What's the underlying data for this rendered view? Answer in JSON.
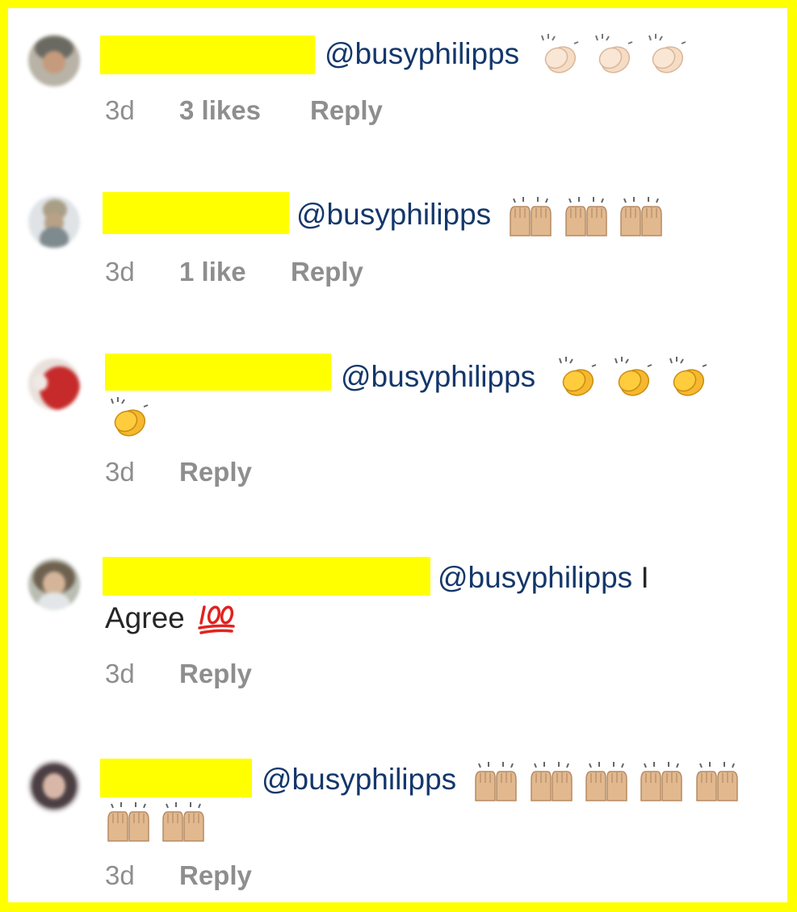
{
  "comments": [
    {
      "mention": "@busyphilipps",
      "text": "",
      "emoji": [
        "clapping-hands-light",
        "clapping-hands-light",
        "clapping-hands-light"
      ],
      "time": "3d",
      "likes": "3 likes",
      "reply": "Reply"
    },
    {
      "mention": "@busyphilipps",
      "text": "",
      "emoji": [
        "raising-hands-medium-light",
        "raising-hands-medium-light",
        "raising-hands-medium-light"
      ],
      "time": "3d",
      "likes": "1 like",
      "reply": "Reply"
    },
    {
      "mention": "@busyphilipps",
      "text": "",
      "emoji": [
        "clapping-hands-yellow",
        "clapping-hands-yellow",
        "clapping-hands-yellow",
        "clapping-hands-yellow"
      ],
      "time": "3d",
      "likes": "",
      "reply": "Reply"
    },
    {
      "mention": "@busyphilipps",
      "text": "I",
      "text2": "Agree",
      "emoji": [
        "hundred-points"
      ],
      "time": "3d",
      "likes": "",
      "reply": "Reply"
    },
    {
      "mention": "@busyphilipps",
      "text": "",
      "emoji": [
        "raising-hands-medium-light",
        "raising-hands-medium-light",
        "raising-hands-medium-light",
        "raising-hands-medium-light",
        "raising-hands-medium-light",
        "raising-hands-medium-light",
        "raising-hands-medium-light"
      ],
      "time": "3d",
      "likes": "",
      "reply": "Reply"
    }
  ],
  "colors": {
    "frame": "#ffff00",
    "mention": "#14376b",
    "meta": "#8e8e8e",
    "redaction": "#ffff00"
  }
}
